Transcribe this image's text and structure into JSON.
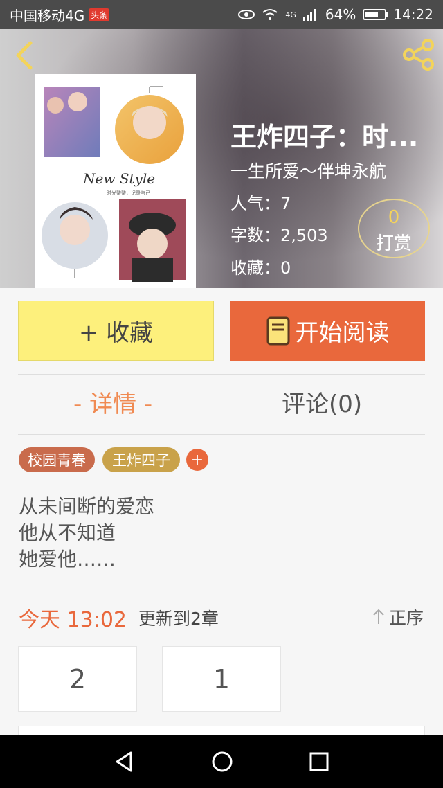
{
  "status_bar": {
    "carrier": "中国移动4G",
    "news_badge": "头条",
    "network": "4G",
    "battery": "64%",
    "time": "14:22"
  },
  "header": {
    "title": "王炸四子：时...",
    "author": "一生所爱～伴坤永航",
    "popularity": "人气：7",
    "word_count": "字数：2,503",
    "favorites": "收藏：0",
    "tip_count": "0",
    "tip_label": "打赏"
  },
  "cover": {
    "caption": "New Style",
    "small_text": "时光整整，记录与己"
  },
  "actions": {
    "favorite_label": "+ 收藏",
    "read_label": "开始阅读"
  },
  "tabs": {
    "detail": "- 详情 -",
    "comments": "评论(0)"
  },
  "tags": [
    "校园青春",
    "王炸四子"
  ],
  "tag_add": "+",
  "description": [
    "从未间断的爱恋",
    "他从不知道",
    "她爱他……"
  ],
  "update": {
    "time": "今天 13:02",
    "text": "更新到2章",
    "sort_label": "正序"
  },
  "chapters": [
    "2",
    "1"
  ],
  "colors": {
    "accent": "#e9683c",
    "favorite_bg": "#fdf07c",
    "tab_active": "#f08a52"
  }
}
